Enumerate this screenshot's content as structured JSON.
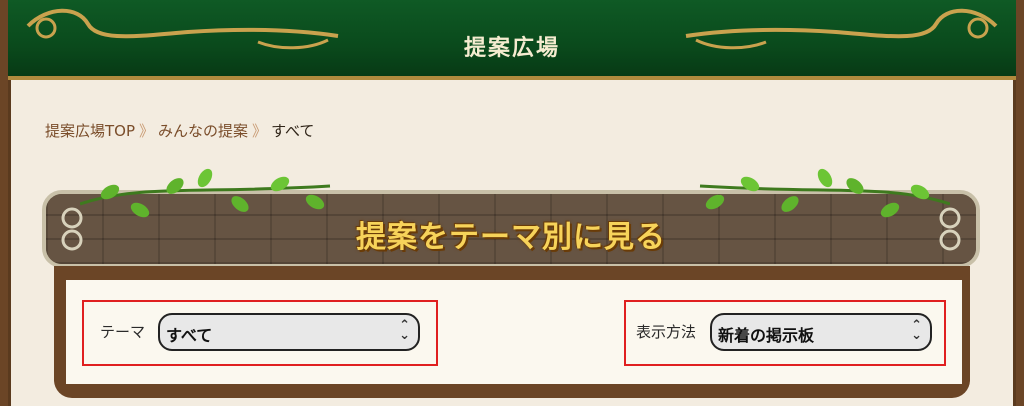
{
  "header": {
    "title": "提案広場"
  },
  "breadcrumb": {
    "items": [
      "提案広場TOP",
      "みんなの提案"
    ],
    "current": "すべて",
    "separator": "》"
  },
  "banner": {
    "title": "提案をテーマ別に見る"
  },
  "filters": {
    "theme": {
      "label": "テーマ",
      "value": "すべて"
    },
    "display": {
      "label": "表示方法",
      "value": "新着の掲示板"
    }
  },
  "colors": {
    "header_green": "#0a4a1c",
    "banner_gold": "#f7d35a",
    "highlight_red": "#e02020",
    "leaf_green": "#5fb32c"
  },
  "icons": {
    "select_arrow": "up-down-chevron-icon",
    "leaf": "vine-leaf-icon"
  }
}
